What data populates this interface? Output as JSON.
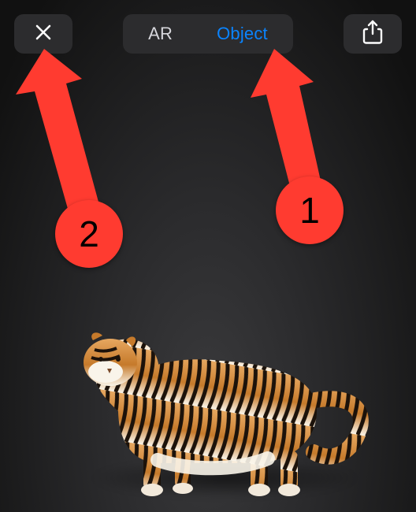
{
  "toolbar": {
    "segmented": {
      "ar_label": "AR",
      "object_label": "Object",
      "active": "object"
    }
  },
  "annotations": {
    "step1": {
      "label": "1",
      "color": "#ff3b30",
      "target": "object-tab"
    },
    "step2": {
      "label": "2",
      "color": "#ff3b30",
      "target": "close-button"
    }
  },
  "content": {
    "model_name": "tiger"
  },
  "colors": {
    "accent_blue": "#0a84ff",
    "annotation_red": "#ff3b30",
    "toolbar_bg": "#2c2c2e"
  }
}
